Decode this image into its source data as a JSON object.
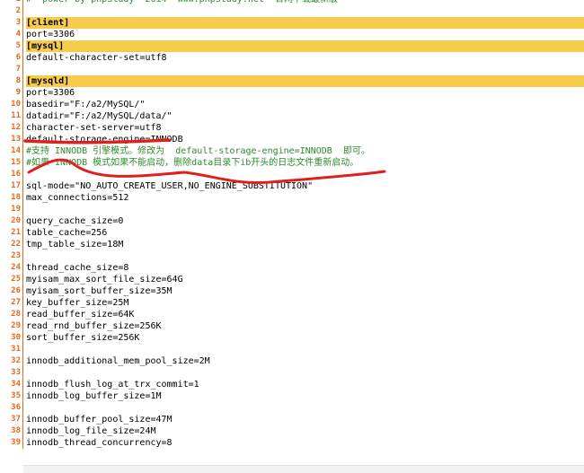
{
  "editor": {
    "lines": [
      {
        "n": "1",
        "t": "#  power by phpStudy  2014  www.phpStudy.net  官网下载最新版"
      },
      {
        "n": "2",
        "t": ""
      },
      {
        "n": "3",
        "t": "[client]"
      },
      {
        "n": "4",
        "t": "port=3306"
      },
      {
        "n": "5",
        "t": "[mysql]"
      },
      {
        "n": "6",
        "t": "default-character-set=utf8"
      },
      {
        "n": "7",
        "t": ""
      },
      {
        "n": "8",
        "t": "[mysqld]"
      },
      {
        "n": "9",
        "t": "port=3306"
      },
      {
        "n": "10",
        "t": "basedir=\"F:/a2/MySQL/\""
      },
      {
        "n": "11",
        "t": "datadir=\"F:/a2/MySQL/data/\""
      },
      {
        "n": "12",
        "t": "character-set-server=utf8"
      },
      {
        "n": "13",
        "t": "default-storage-engine=INNODB"
      },
      {
        "n": "14",
        "t": "#支持 INNODB 引擎模式。修改为  default-storage-engine=INNODB  即可。"
      },
      {
        "n": "15",
        "t": "#如果 INNODB 模式如果不能启动，删除data目录下ib开头的日志文件重新启动。"
      },
      {
        "n": "16",
        "t": ""
      },
      {
        "n": "17",
        "t": "sql-mode=\"NO_AUTO_CREATE_USER,NO_ENGINE_SUBSTITUTION\""
      },
      {
        "n": "18",
        "t": "max_connections=512"
      },
      {
        "n": "19",
        "t": ""
      },
      {
        "n": "20",
        "t": "query_cache_size=0"
      },
      {
        "n": "21",
        "t": "table_cache=256"
      },
      {
        "n": "22",
        "t": "tmp_table_size=18M"
      },
      {
        "n": "23",
        "t": ""
      },
      {
        "n": "24",
        "t": "thread_cache_size=8"
      },
      {
        "n": "25",
        "t": "myisam_max_sort_file_size=64G"
      },
      {
        "n": "26",
        "t": "myisam_sort_buffer_size=35M"
      },
      {
        "n": "27",
        "t": "key_buffer_size=25M"
      },
      {
        "n": "28",
        "t": "read_buffer_size=64K"
      },
      {
        "n": "29",
        "t": "read_rnd_buffer_size=256K"
      },
      {
        "n": "30",
        "t": "sort_buffer_size=256K"
      },
      {
        "n": "31",
        "t": ""
      },
      {
        "n": "32",
        "t": "innodb_additional_mem_pool_size=2M"
      },
      {
        "n": "33",
        "t": ""
      },
      {
        "n": "34",
        "t": "innodb_flush_log_at_trx_commit=1"
      },
      {
        "n": "35",
        "t": "innodb_log_buffer_size=1M"
      },
      {
        "n": "36",
        "t": ""
      },
      {
        "n": "37",
        "t": "innodb_buffer_pool_size=47M"
      },
      {
        "n": "38",
        "t": "innodb_log_file_size=24M"
      },
      {
        "n": "39",
        "t": "innodb_thread_concurrency=8"
      }
    ]
  },
  "colors": {
    "section_highlight": "#f8cc4b",
    "line_numbers": "#e46a1b",
    "comment": "#2e8b2e",
    "annotation_ink": "#e02020"
  }
}
